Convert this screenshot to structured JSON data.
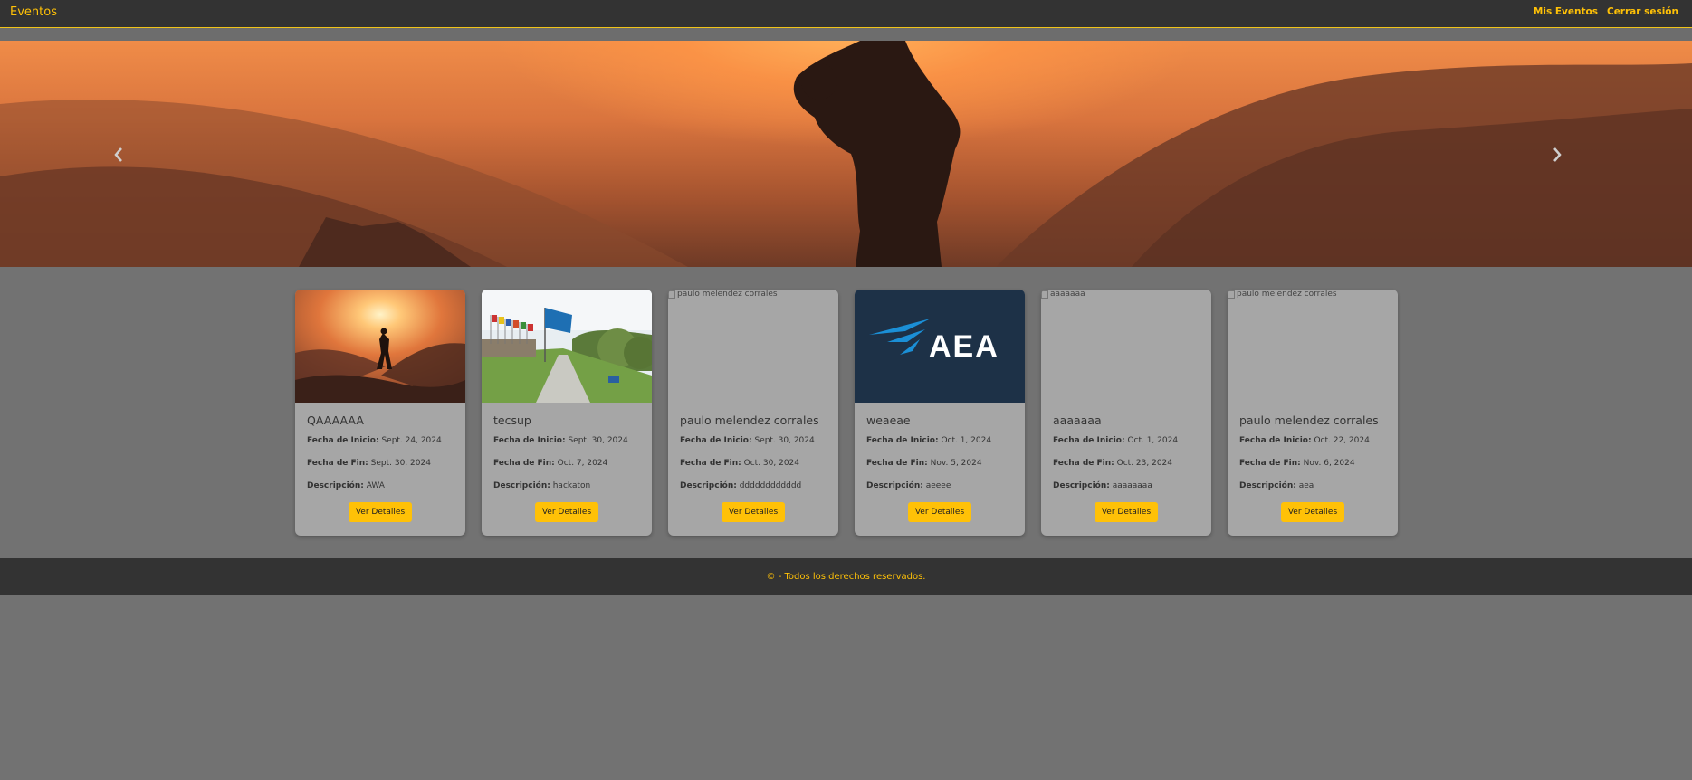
{
  "navbar": {
    "brand": "Eventos",
    "links": [
      "Mis Eventos",
      "Cerrar sesión"
    ]
  },
  "carousel": {
    "prev_icon": "chevron-left-icon",
    "next_icon": "chevron-right-icon"
  },
  "labels": {
    "start": "Fecha de Inicio:",
    "end": "Fecha de Fin:",
    "description": "Descripción:",
    "button": "Ver Detalles"
  },
  "events": [
    {
      "title": "QAAAAAA",
      "start": "Sept. 24, 2024",
      "end": "Sept. 30, 2024",
      "description": "AWA",
      "image": "sunset-silhouette",
      "alt": ""
    },
    {
      "title": "tecsup",
      "start": "Sept. 30, 2024",
      "end": "Oct. 7, 2024",
      "description": "hackaton",
      "image": "campus-flags",
      "alt": ""
    },
    {
      "title": "paulo melendez corrales",
      "start": "Sept. 30, 2024",
      "end": "Oct. 30, 2024",
      "description": "dddddddddddd",
      "image": "broken",
      "alt": "paulo melendez corrales"
    },
    {
      "title": "weaeae",
      "start": "Oct. 1, 2024",
      "end": "Nov. 5, 2024",
      "description": "aeeee",
      "image": "aea-logo",
      "alt": "",
      "logo_text": "AEA"
    },
    {
      "title": "aaaaaaa",
      "start": "Oct. 1, 2024",
      "end": "Oct. 23, 2024",
      "description": "aaaaaaaa",
      "image": "broken",
      "alt": "aaaaaaa"
    },
    {
      "title": "paulo melendez corrales",
      "start": "Oct. 22, 2024",
      "end": "Nov. 6, 2024",
      "description": "aea",
      "image": "broken",
      "alt": "paulo melendez corrales"
    }
  ],
  "footer": {
    "text": "© - Todos los derechos reservados."
  },
  "colors": {
    "accent": "#ffc107",
    "navbar": "#333333",
    "card": "#a6a6a6",
    "page": "#727272"
  }
}
